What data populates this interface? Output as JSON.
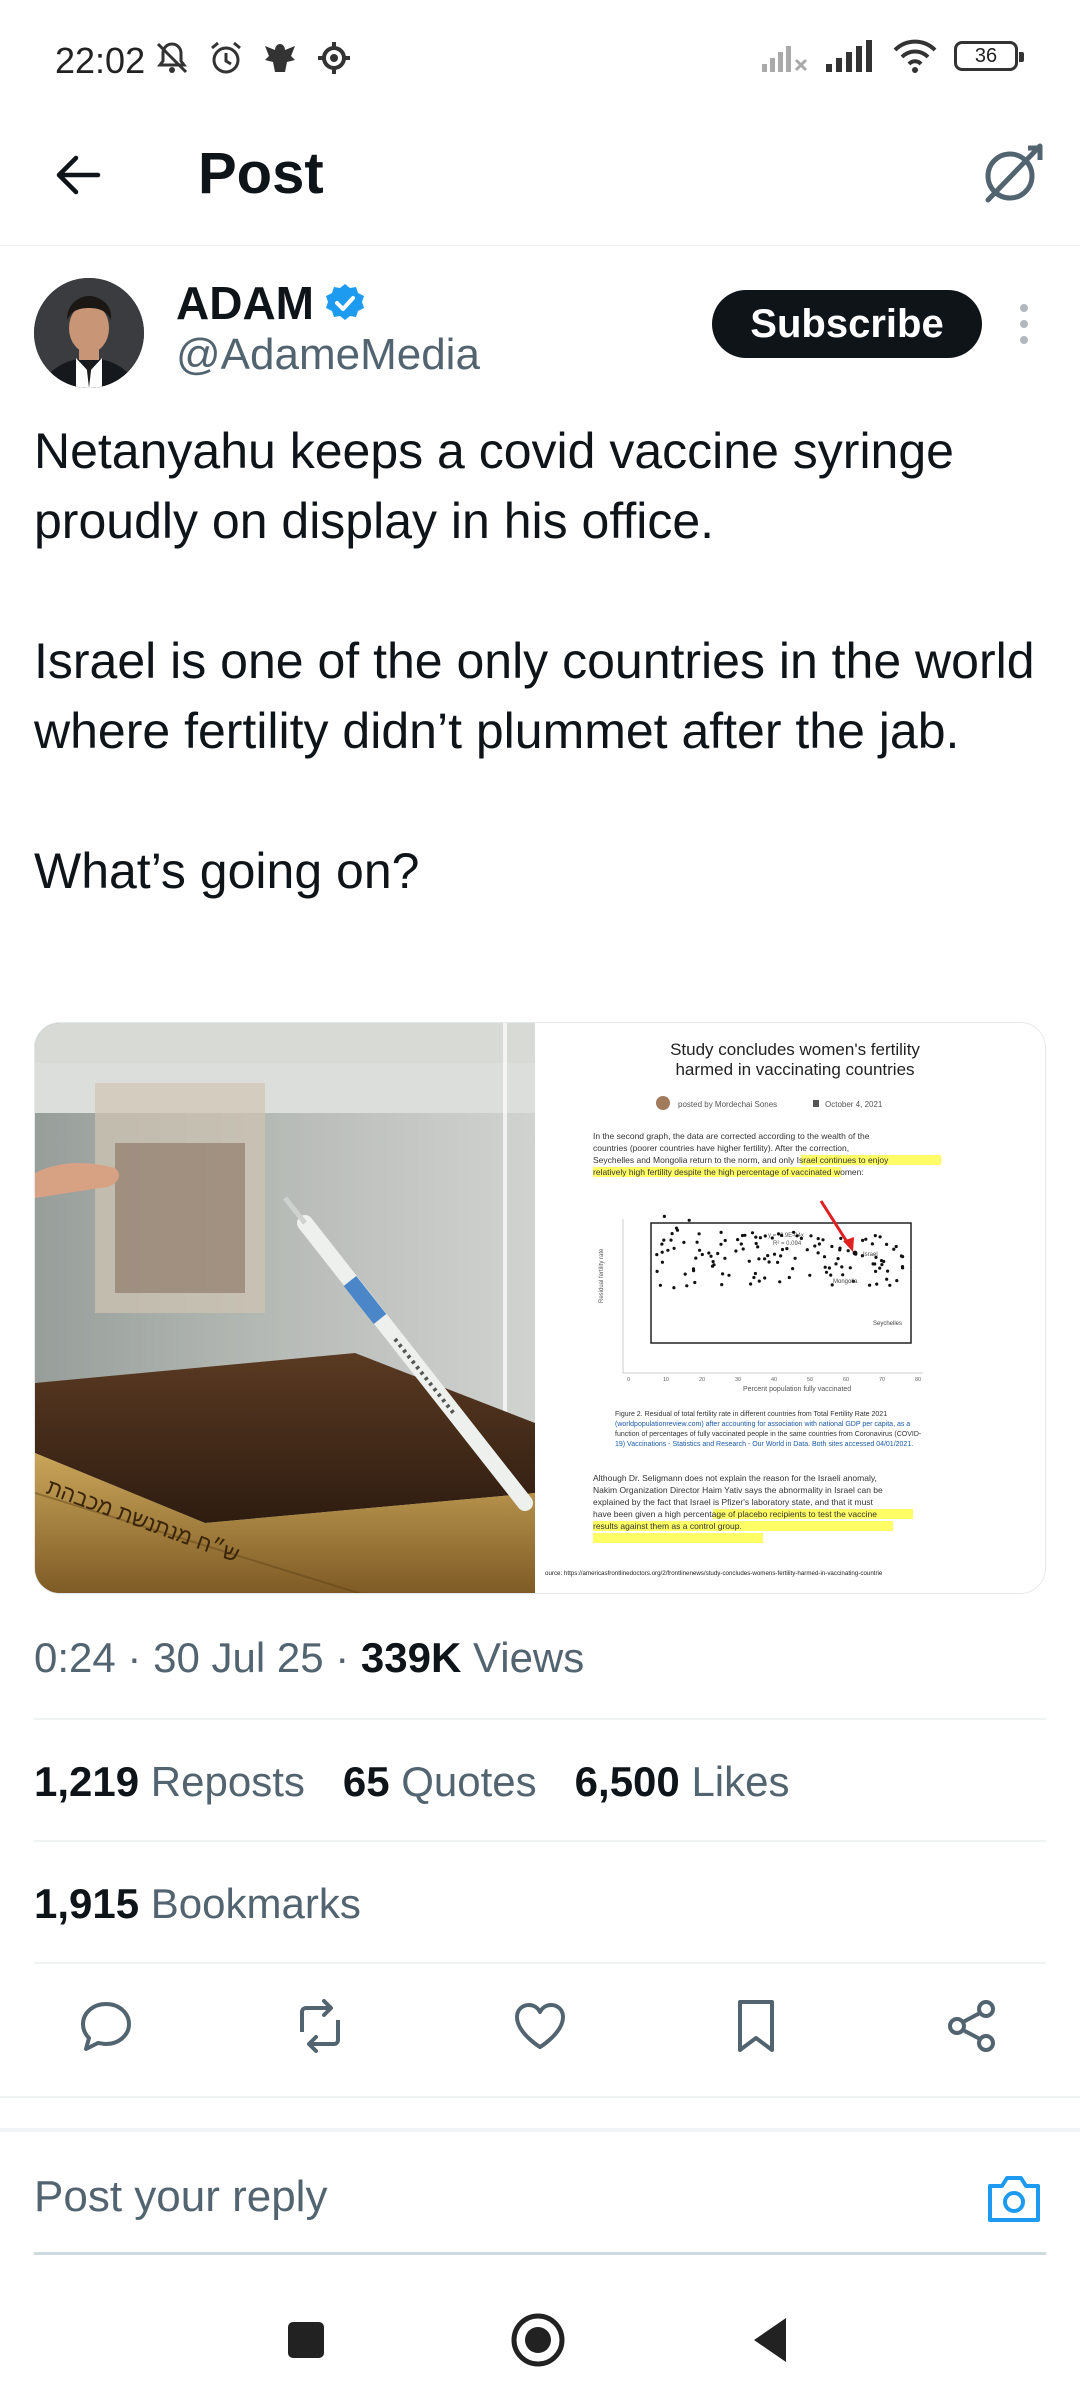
{
  "status_bar": {
    "time": "22:02",
    "battery": "36",
    "left_icons": [
      "dnd-off-icon",
      "alarm-icon",
      "eagle-icon",
      "settings-icon"
    ],
    "right_icons": [
      "signal-off-icon",
      "signal-icon",
      "wifi-icon",
      "battery-icon"
    ]
  },
  "header": {
    "title": "Post",
    "back_icon": "arrow-left-icon",
    "grok_icon": "grok-icon"
  },
  "author": {
    "name": "ADAM",
    "handle": "@AdameMedia",
    "verified": true,
    "subscribe_label": "Subscribe"
  },
  "post": {
    "paragraphs": [
      "Netanyahu keeps a covid vaccine syringe proudly on display in his office.",
      "Israel is one of the only countries in the world where fertility didn’t plummet after the jab.",
      "What’s going on?"
    ]
  },
  "media_right": {
    "title_line1": "Study concludes women's fertility",
    "title_line2": "harmed in vaccinating countries",
    "byline": "posted by Mordechai Sones",
    "date": "October 4, 2021",
    "para1_lines": [
      "In the second graph, the data are corrected according to the wealth of the",
      "countries (poorer countries have higher fertility). After the correction,",
      "Seychelles and Mongolia return to the norm, and only Israel continues to enjoy",
      "relatively high fertility despite the high percentage of vaccinated women:"
    ],
    "chart_israel": "Israel",
    "chart_mongolia": "Mongolia",
    "chart_seychelles": "Seychelles",
    "chart_xlabel": "Percent population fully vaccinated",
    "chart_ylabel": "Residual fertility rate",
    "chart_eq": "y = -2.9E-04x",
    "chart_r2": "R² = 0.094",
    "chart_xticks": [
      "0",
      "10",
      "20",
      "30",
      "40",
      "50",
      "60",
      "70",
      "80"
    ],
    "figure_lines": [
      "Figure 2. Residual of total fertility rate in different countries from Total Fertility Rate 2021",
      "(worldpopulationreview.com) after accounting for association with national GDP per capita, as a",
      "function of percentages of fully vaccinated people in the same countries from Coronavirus (COVID-",
      "19) Vaccinations - Statistics and Research - Our World in Data. Both sites accessed 04/01/2021."
    ],
    "para2_lines": [
      "Although Dr. Seligmann does not explain the reason for the Israeli anomaly,",
      "Nakim Organization Director Haim Yativ says the abnormality in Israel can be",
      "explained by the fact that Israel is Pfizer's laboratory state, and that it must",
      "have been given a high percentage of placebo recipients to test the vaccine",
      "results against them as a control group."
    ],
    "source": "ource: https://americasfrontlinedoctors.org/2/frontlinenews/study-concludes-womens-fertility-harmed-in-vaccinating-countrie",
    "plaque_text": "ש״ח מנתנשת מכבהת"
  },
  "meta": {
    "time": "0:24",
    "date": "30 Jul 25",
    "views_count": "339K",
    "views_label": "Views",
    "sep": "·"
  },
  "stats": {
    "reposts_count": "1,219",
    "reposts_label": "Reposts",
    "quotes_count": "65",
    "quotes_label": "Quotes",
    "likes_count": "6,500",
    "likes_label": "Likes",
    "bookmarks_count": "1,915",
    "bookmarks_label": "Bookmarks"
  },
  "reply": {
    "placeholder": "Post your reply"
  },
  "colors": {
    "text": "#0f1419",
    "secondary": "#536471",
    "accent": "#1d9bf0",
    "divider": "#eff3f4",
    "highlight": "#ffff66"
  }
}
